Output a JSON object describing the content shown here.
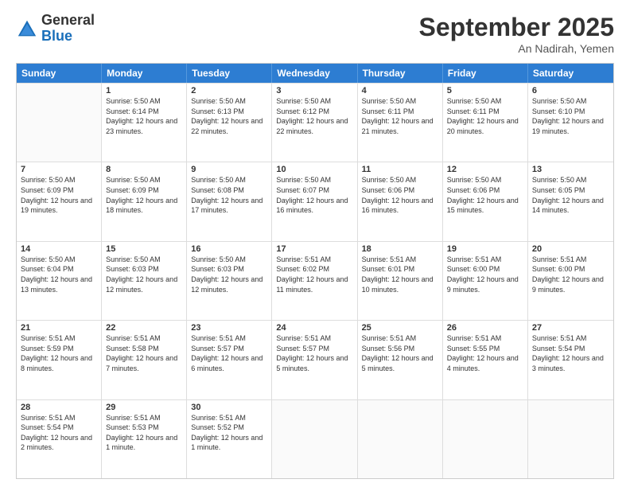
{
  "header": {
    "logo": {
      "general": "General",
      "blue": "Blue"
    },
    "title": "September 2025",
    "subtitle": "An Nadirah, Yemen"
  },
  "calendar": {
    "days": [
      "Sunday",
      "Monday",
      "Tuesday",
      "Wednesday",
      "Thursday",
      "Friday",
      "Saturday"
    ],
    "rows": [
      [
        {
          "day": "",
          "empty": true
        },
        {
          "day": "1",
          "sunrise": "5:50 AM",
          "sunset": "6:14 PM",
          "daylight": "12 hours and 23 minutes."
        },
        {
          "day": "2",
          "sunrise": "5:50 AM",
          "sunset": "6:13 PM",
          "daylight": "12 hours and 22 minutes."
        },
        {
          "day": "3",
          "sunrise": "5:50 AM",
          "sunset": "6:12 PM",
          "daylight": "12 hours and 22 minutes."
        },
        {
          "day": "4",
          "sunrise": "5:50 AM",
          "sunset": "6:11 PM",
          "daylight": "12 hours and 21 minutes."
        },
        {
          "day": "5",
          "sunrise": "5:50 AM",
          "sunset": "6:11 PM",
          "daylight": "12 hours and 20 minutes."
        },
        {
          "day": "6",
          "sunrise": "5:50 AM",
          "sunset": "6:10 PM",
          "daylight": "12 hours and 19 minutes."
        }
      ],
      [
        {
          "day": "7",
          "sunrise": "5:50 AM",
          "sunset": "6:09 PM",
          "daylight": "12 hours and 19 minutes."
        },
        {
          "day": "8",
          "sunrise": "5:50 AM",
          "sunset": "6:09 PM",
          "daylight": "12 hours and 18 minutes."
        },
        {
          "day": "9",
          "sunrise": "5:50 AM",
          "sunset": "6:08 PM",
          "daylight": "12 hours and 17 minutes."
        },
        {
          "day": "10",
          "sunrise": "5:50 AM",
          "sunset": "6:07 PM",
          "daylight": "12 hours and 16 minutes."
        },
        {
          "day": "11",
          "sunrise": "5:50 AM",
          "sunset": "6:06 PM",
          "daylight": "12 hours and 16 minutes."
        },
        {
          "day": "12",
          "sunrise": "5:50 AM",
          "sunset": "6:06 PM",
          "daylight": "12 hours and 15 minutes."
        },
        {
          "day": "13",
          "sunrise": "5:50 AM",
          "sunset": "6:05 PM",
          "daylight": "12 hours and 14 minutes."
        }
      ],
      [
        {
          "day": "14",
          "sunrise": "5:50 AM",
          "sunset": "6:04 PM",
          "daylight": "12 hours and 13 minutes."
        },
        {
          "day": "15",
          "sunrise": "5:50 AM",
          "sunset": "6:03 PM",
          "daylight": "12 hours and 12 minutes."
        },
        {
          "day": "16",
          "sunrise": "5:50 AM",
          "sunset": "6:03 PM",
          "daylight": "12 hours and 12 minutes."
        },
        {
          "day": "17",
          "sunrise": "5:51 AM",
          "sunset": "6:02 PM",
          "daylight": "12 hours and 11 minutes."
        },
        {
          "day": "18",
          "sunrise": "5:51 AM",
          "sunset": "6:01 PM",
          "daylight": "12 hours and 10 minutes."
        },
        {
          "day": "19",
          "sunrise": "5:51 AM",
          "sunset": "6:00 PM",
          "daylight": "12 hours and 9 minutes."
        },
        {
          "day": "20",
          "sunrise": "5:51 AM",
          "sunset": "6:00 PM",
          "daylight": "12 hours and 9 minutes."
        }
      ],
      [
        {
          "day": "21",
          "sunrise": "5:51 AM",
          "sunset": "5:59 PM",
          "daylight": "12 hours and 8 minutes."
        },
        {
          "day": "22",
          "sunrise": "5:51 AM",
          "sunset": "5:58 PM",
          "daylight": "12 hours and 7 minutes."
        },
        {
          "day": "23",
          "sunrise": "5:51 AM",
          "sunset": "5:57 PM",
          "daylight": "12 hours and 6 minutes."
        },
        {
          "day": "24",
          "sunrise": "5:51 AM",
          "sunset": "5:57 PM",
          "daylight": "12 hours and 5 minutes."
        },
        {
          "day": "25",
          "sunrise": "5:51 AM",
          "sunset": "5:56 PM",
          "daylight": "12 hours and 5 minutes."
        },
        {
          "day": "26",
          "sunrise": "5:51 AM",
          "sunset": "5:55 PM",
          "daylight": "12 hours and 4 minutes."
        },
        {
          "day": "27",
          "sunrise": "5:51 AM",
          "sunset": "5:54 PM",
          "daylight": "12 hours and 3 minutes."
        }
      ],
      [
        {
          "day": "28",
          "sunrise": "5:51 AM",
          "sunset": "5:54 PM",
          "daylight": "12 hours and 2 minutes."
        },
        {
          "day": "29",
          "sunrise": "5:51 AM",
          "sunset": "5:53 PM",
          "daylight": "12 hours and 1 minute."
        },
        {
          "day": "30",
          "sunrise": "5:51 AM",
          "sunset": "5:52 PM",
          "daylight": "12 hours and 1 minute."
        },
        {
          "day": "",
          "empty": true
        },
        {
          "day": "",
          "empty": true
        },
        {
          "day": "",
          "empty": true
        },
        {
          "day": "",
          "empty": true
        }
      ]
    ]
  }
}
